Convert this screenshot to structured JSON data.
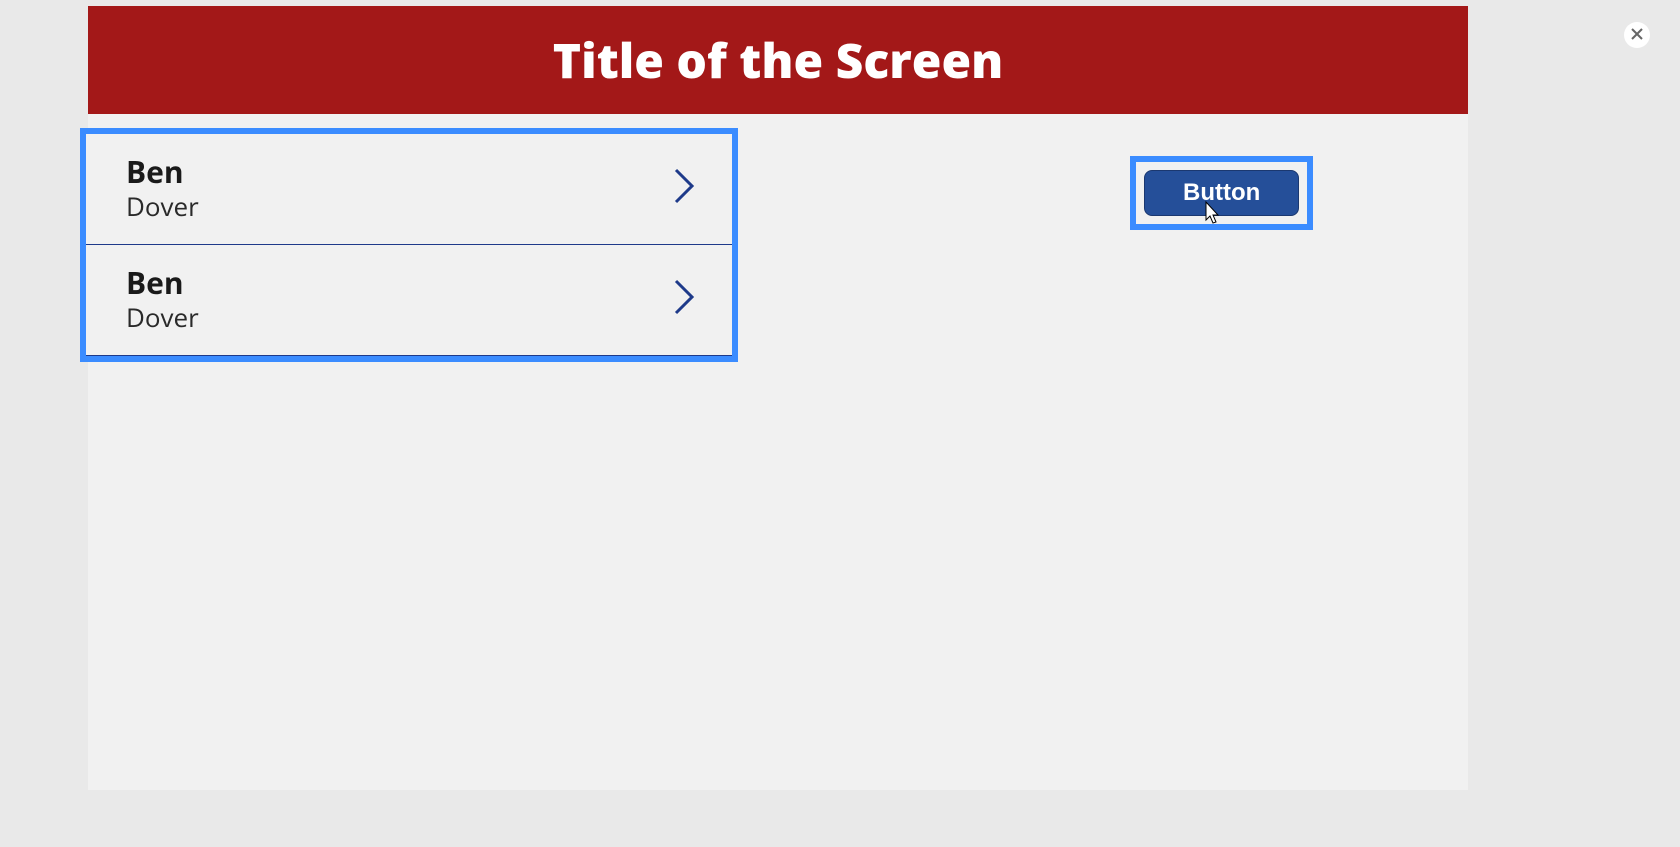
{
  "header": {
    "title": "Title of the Screen"
  },
  "list": {
    "items": [
      {
        "title": "Ben",
        "subtitle": "Dover"
      },
      {
        "title": "Ben",
        "subtitle": "Dover"
      }
    ]
  },
  "actions": {
    "button_label": "Button"
  },
  "icons": {
    "close": "close",
    "chevron": "chevron-right",
    "cursor": "pointer-cursor"
  },
  "colors": {
    "header_bg": "#a31818",
    "highlight_border": "#3b8cff",
    "button_bg": "#254f99",
    "divider": "#1e3a8a"
  }
}
